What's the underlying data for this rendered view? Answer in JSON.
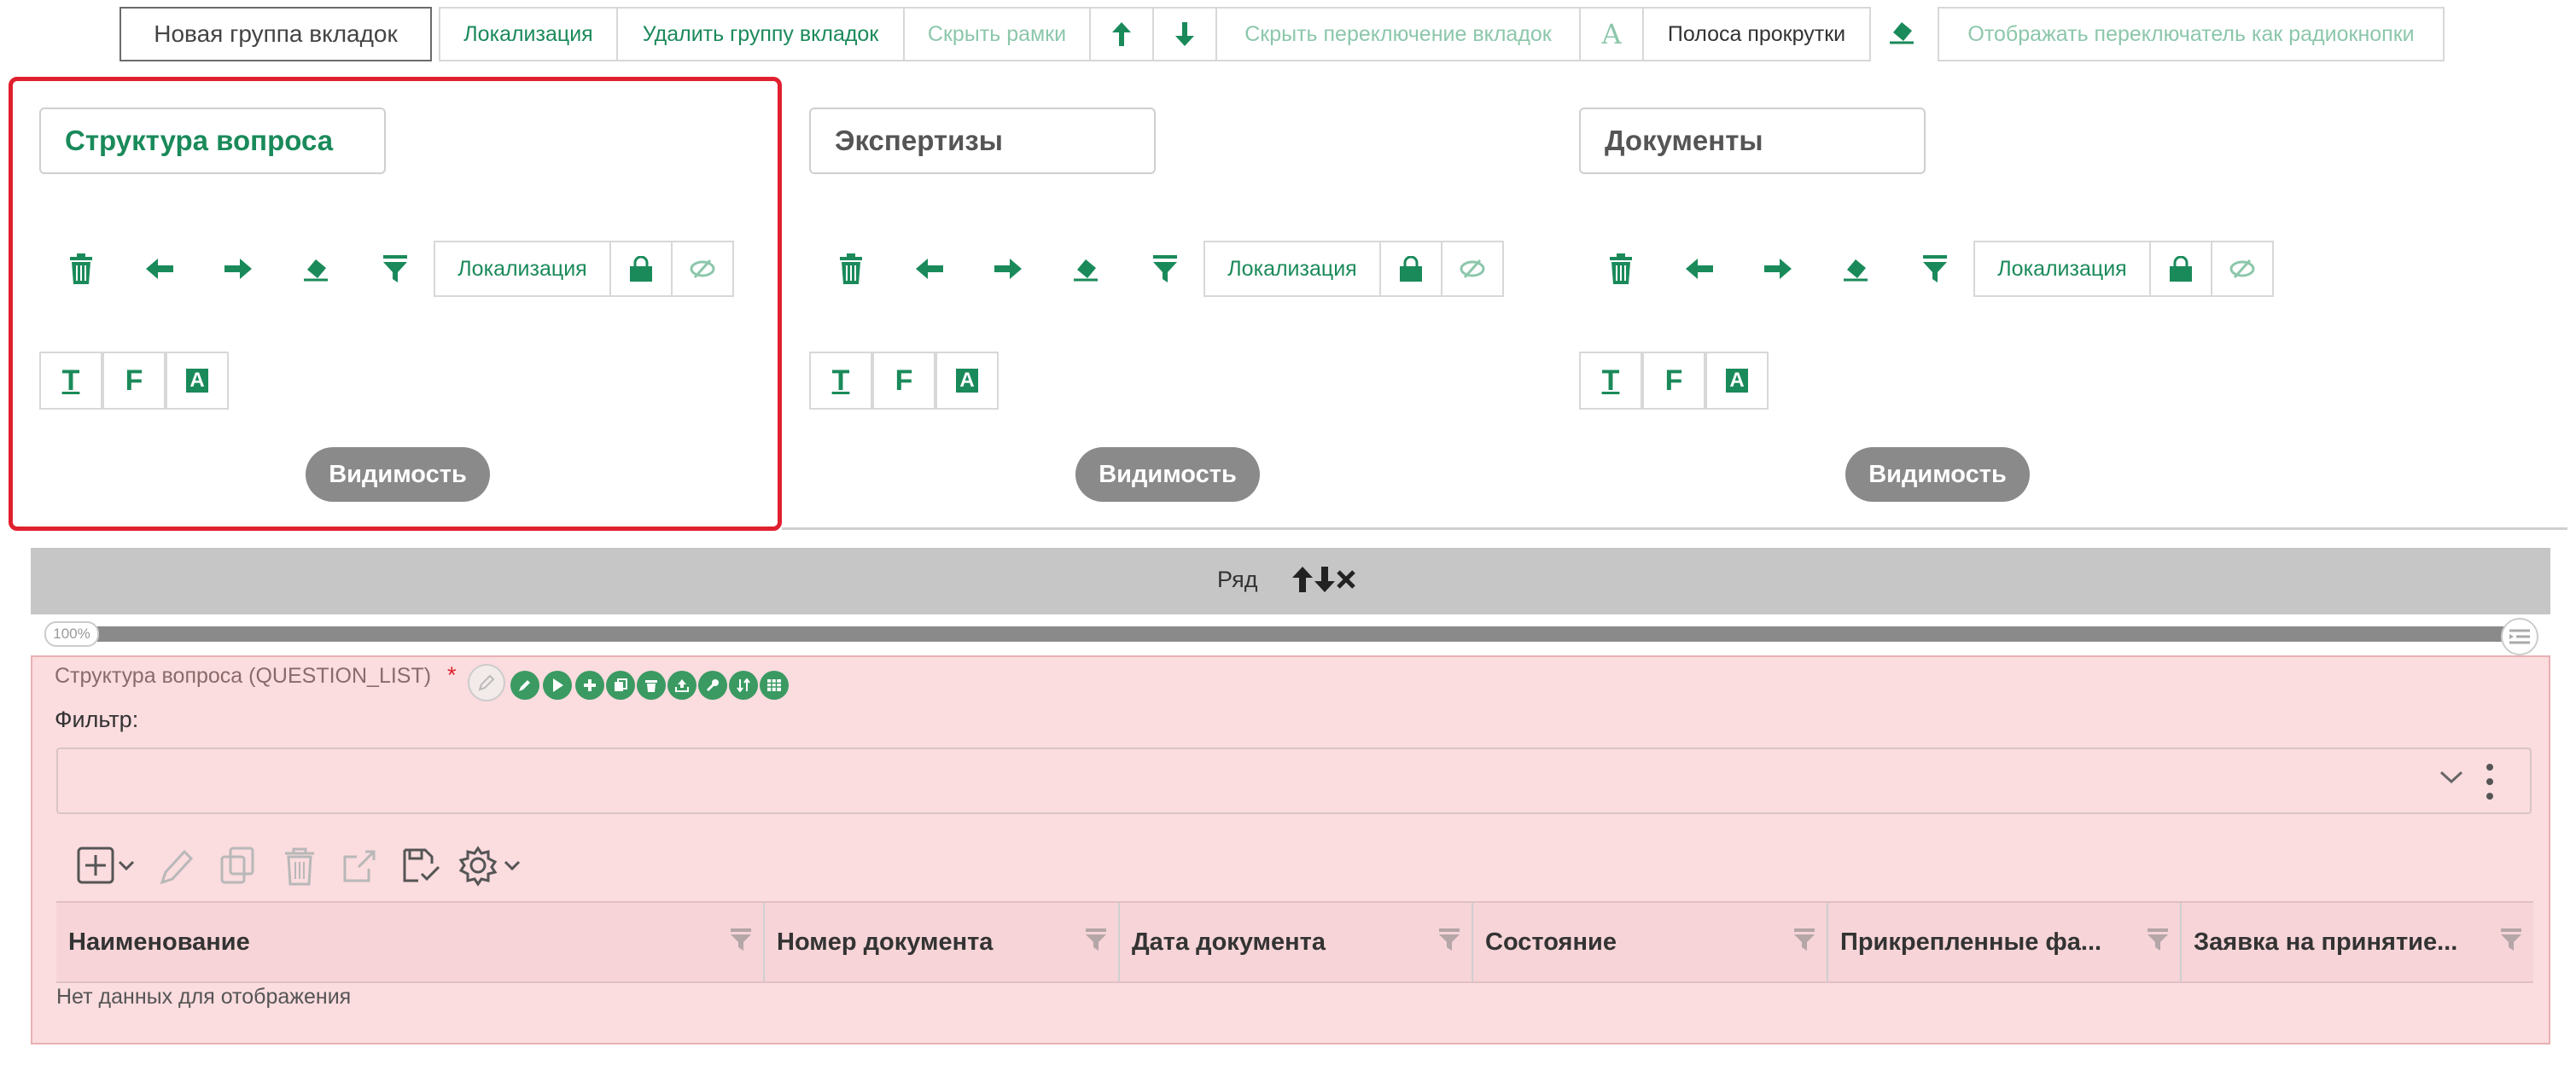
{
  "toolbar": {
    "new_group": "Новая группа вкладок",
    "localization": "Локализация",
    "delete_group": "Удалить группу вкладок",
    "hide_frames": "Скрыть рамки",
    "hide_tab_switch": "Скрыть переключение вкладок",
    "font_icon": "A",
    "scrollbar": "Полоса прокрутки",
    "radio_switch": "Отображать переключатель как радиокнопки"
  },
  "tabs": [
    {
      "title": "Структура вопроса",
      "localization": "Локализация",
      "visibility": "Видимость",
      "fmt": [
        "T",
        "F",
        "A"
      ]
    },
    {
      "title": "Экспертизы",
      "localization": "Локализация",
      "visibility": "Видимость",
      "fmt": [
        "T",
        "F",
        "A"
      ]
    },
    {
      "title": "Документы",
      "localization": "Локализация",
      "visibility": "Видимость",
      "fmt": [
        "T",
        "F",
        "A"
      ]
    }
  ],
  "row": {
    "label": "Ряд",
    "width_badge": "100%"
  },
  "field": {
    "title": "Структура вопроса (QUESTION_LIST)",
    "required_mark": "*",
    "filter_label": "Фильтр:",
    "filter_value": ""
  },
  "table": {
    "columns": [
      "Наименование",
      "Номер документа",
      "Дата документа",
      "Состояние",
      "Прикрепленные фа...",
      "Заявка на принятие..."
    ],
    "empty_text": "Нет данных для отображения"
  },
  "colors": {
    "accent": "#1a8a5a",
    "selection": "#e0202e",
    "panel_bg": "#fbdcdf",
    "row_bar": "#c6c6c6"
  }
}
